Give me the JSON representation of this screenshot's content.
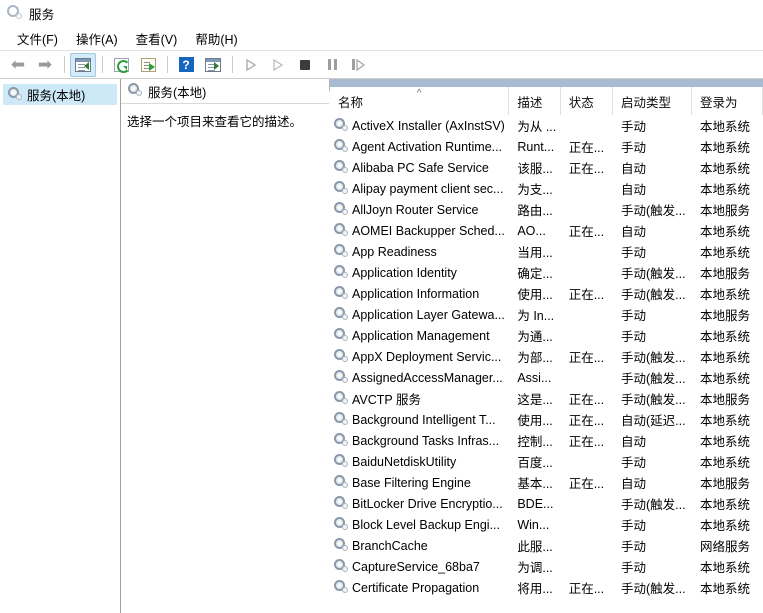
{
  "window": {
    "title": "服务",
    "icon": "services-cog-icon"
  },
  "menubar": {
    "items": [
      {
        "label": "文件(F)",
        "name": "menu-file"
      },
      {
        "label": "操作(A)",
        "name": "menu-action"
      },
      {
        "label": "查看(V)",
        "name": "menu-view"
      },
      {
        "label": "帮助(H)",
        "name": "menu-help"
      }
    ]
  },
  "toolbar": {
    "buttons": [
      {
        "name": "back-button",
        "icon": "arrow-left-icon",
        "glyph": "⬅",
        "enabled": true
      },
      {
        "name": "forward-button",
        "icon": "arrow-right-icon",
        "glyph": "➡",
        "enabled": true
      },
      {
        "name": "show-hide-tree-button",
        "icon": "show-tree-icon",
        "active": true
      },
      {
        "name": "refresh-button",
        "icon": "refresh-icon",
        "active": false
      },
      {
        "name": "export-list-button",
        "icon": "export-list-icon",
        "active": false
      },
      {
        "name": "help-button",
        "icon": "help-question-icon",
        "active": false
      },
      {
        "name": "show-action-pane-button",
        "icon": "action-pane-icon",
        "active": false
      },
      {
        "name": "start-service-button",
        "icon": "play-icon",
        "enabled": false
      },
      {
        "name": "resume-service-button",
        "icon": "play-outline-icon",
        "enabled": false
      },
      {
        "name": "stop-service-button",
        "icon": "stop-square-icon",
        "enabled": false
      },
      {
        "name": "pause-service-button",
        "icon": "pause-icon",
        "enabled": false
      },
      {
        "name": "restart-service-button",
        "icon": "restart-icon",
        "enabled": false
      }
    ]
  },
  "tree": {
    "root_label": "服务(本地)",
    "root_icon": "services-cog-icon"
  },
  "detail": {
    "header_label": "服务(本地)",
    "header_icon": "services-cog-icon",
    "empty_message": "选择一个项目来查看它的描述。"
  },
  "list": {
    "sort_column": "名称",
    "sort_direction": "asc",
    "sort_indicator": "^",
    "columns": [
      {
        "key": "name",
        "label": "名称"
      },
      {
        "key": "desc",
        "label": "描述"
      },
      {
        "key": "status",
        "label": "状态"
      },
      {
        "key": "start",
        "label": "启动类型"
      },
      {
        "key": "logon",
        "label": "登录为"
      }
    ],
    "rows": [
      {
        "name": "ActiveX Installer (AxInstSV)",
        "desc": "为从 ...",
        "status": "",
        "start": "手动",
        "logon": "本地系统"
      },
      {
        "name": "Agent Activation Runtime...",
        "desc": "Runt...",
        "status": "正在...",
        "start": "手动",
        "logon": "本地系统"
      },
      {
        "name": "Alibaba PC Safe Service",
        "desc": "该服...",
        "status": "正在...",
        "start": "自动",
        "logon": "本地系统"
      },
      {
        "name": "Alipay payment client sec...",
        "desc": "为支...",
        "status": "",
        "start": "自动",
        "logon": "本地系统"
      },
      {
        "name": "AllJoyn Router Service",
        "desc": "路由...",
        "status": "",
        "start": "手动(触发...",
        "logon": "本地服务"
      },
      {
        "name": "AOMEI Backupper Sched...",
        "desc": "AO...",
        "status": "正在...",
        "start": "自动",
        "logon": "本地系统"
      },
      {
        "name": "App Readiness",
        "desc": "当用...",
        "status": "",
        "start": "手动",
        "logon": "本地系统"
      },
      {
        "name": "Application Identity",
        "desc": "确定...",
        "status": "",
        "start": "手动(触发...",
        "logon": "本地服务"
      },
      {
        "name": "Application Information",
        "desc": "使用...",
        "status": "正在...",
        "start": "手动(触发...",
        "logon": "本地系统"
      },
      {
        "name": "Application Layer Gatewa...",
        "desc": "为 In...",
        "status": "",
        "start": "手动",
        "logon": "本地服务"
      },
      {
        "name": "Application Management",
        "desc": "为通...",
        "status": "",
        "start": "手动",
        "logon": "本地系统"
      },
      {
        "name": "AppX Deployment Servic...",
        "desc": "为部...",
        "status": "正在...",
        "start": "手动(触发...",
        "logon": "本地系统"
      },
      {
        "name": "AssignedAccessManager...",
        "desc": "Assi...",
        "status": "",
        "start": "手动(触发...",
        "logon": "本地系统"
      },
      {
        "name": "AVCTP 服务",
        "desc": "这是...",
        "status": "正在...",
        "start": "手动(触发...",
        "logon": "本地服务"
      },
      {
        "name": "Background Intelligent T...",
        "desc": "使用...",
        "status": "正在...",
        "start": "自动(延迟...",
        "logon": "本地系统"
      },
      {
        "name": "Background Tasks Infras...",
        "desc": "控制...",
        "status": "正在...",
        "start": "自动",
        "logon": "本地系统"
      },
      {
        "name": "BaiduNetdiskUtility",
        "desc": "百度...",
        "status": "",
        "start": "手动",
        "logon": "本地系统"
      },
      {
        "name": "Base Filtering Engine",
        "desc": "基本...",
        "status": "正在...",
        "start": "自动",
        "logon": "本地服务"
      },
      {
        "name": "BitLocker Drive Encryptio...",
        "desc": "BDE...",
        "status": "",
        "start": "手动(触发...",
        "logon": "本地系统"
      },
      {
        "name": "Block Level Backup Engi...",
        "desc": "Win...",
        "status": "",
        "start": "手动",
        "logon": "本地系统"
      },
      {
        "name": "BranchCache",
        "desc": "此服...",
        "status": "",
        "start": "手动",
        "logon": "网络服务"
      },
      {
        "name": "CaptureService_68ba7",
        "desc": "为调...",
        "status": "",
        "start": "手动",
        "logon": "本地系统"
      },
      {
        "name": "Certificate Propagation",
        "desc": "将用...",
        "status": "正在...",
        "start": "手动(触发...",
        "logon": "本地系统"
      }
    ]
  },
  "colors": {
    "band": "#a7bcd2",
    "tree_selection": "#cde8f7",
    "toolbar_active": "#d6ebf9",
    "help_blue": "#1666c0",
    "gear_gray": "#8a98a7"
  }
}
